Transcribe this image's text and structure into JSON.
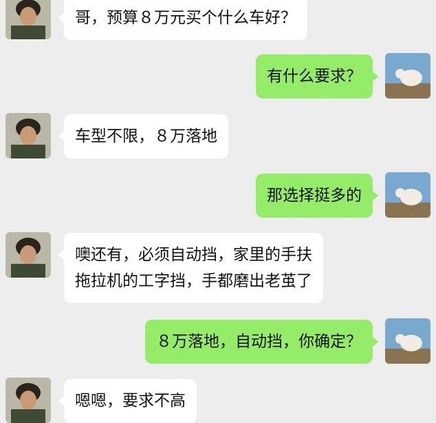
{
  "colors": {
    "background": "#ededed",
    "incoming_bubble": "#ffffff",
    "outgoing_bubble": "#95ec69"
  },
  "messages": [
    {
      "from": "contact",
      "lines": [
        "哥，预算８万元买个什么车好？"
      ]
    },
    {
      "from": "me",
      "lines": [
        "有什么要求？"
      ]
    },
    {
      "from": "contact",
      "lines": [
        "车型不限，８万落地"
      ]
    },
    {
      "from": "me",
      "lines": [
        "那选择挺多的"
      ]
    },
    {
      "from": "contact",
      "lines": [
        "噢还有，必须自动挡，家里的手扶",
        "拖拉机的工字挡，手都磨出老茧了"
      ]
    },
    {
      "from": "me",
      "lines": [
        "８万落地，自动挡，你确定？"
      ]
    },
    {
      "from": "contact",
      "lines": [
        "嗯嗯，要求不高"
      ]
    }
  ]
}
